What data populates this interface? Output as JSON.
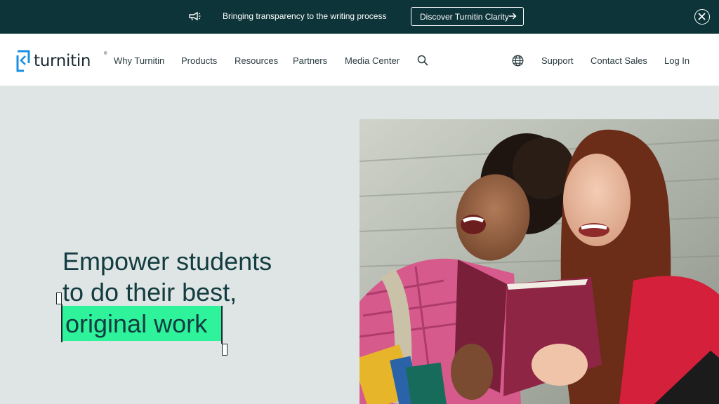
{
  "announcement": {
    "icon": "megaphone-icon",
    "message": "Bringing transparency to the writing process",
    "cta_label": "Discover Turnitin Clarity",
    "cta_icon": "arrow-right-icon",
    "close_icon": "close-icon"
  },
  "nav": {
    "logo_text": "turnitin",
    "logo_tm": "®",
    "links": [
      "Why Turnitin",
      "Products",
      "Resources",
      "Partners",
      "Media Center"
    ],
    "search_icon": "search-icon",
    "globe_icon": "globe-icon",
    "right_links": [
      "Support",
      "Contact Sales",
      "Log In"
    ]
  },
  "hero": {
    "headline_line1": "Empower students",
    "headline_line2": "to do their best,",
    "highlight_text": "original work",
    "image_alt": "Two students laughing while reading a book"
  },
  "colors": {
    "announce_bg": "#0d3438",
    "hero_bg": "#dfe5e4",
    "highlight": "#2ef39b",
    "brand_blue": "#1a8fe3",
    "heading": "#123c40"
  }
}
